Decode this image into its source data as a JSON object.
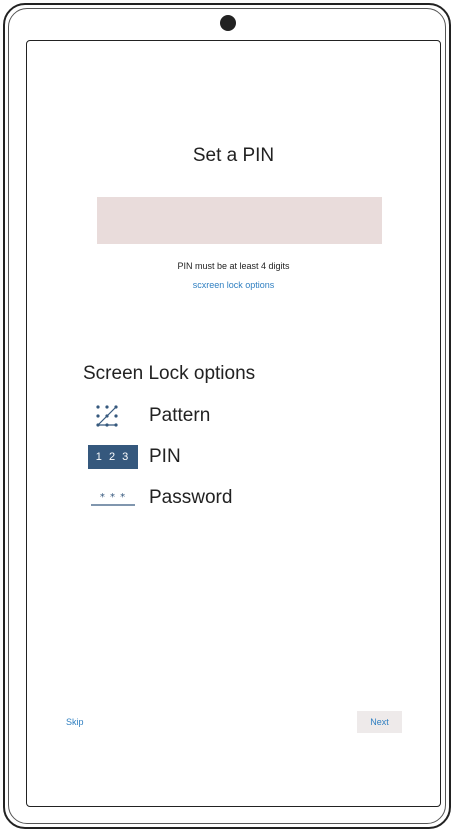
{
  "pin_setup": {
    "title": "Set a PIN",
    "input_value": "",
    "input_placeholder": "",
    "hint": "PIN must be at least 4 digits",
    "lock_options_link": "scxreen lock options"
  },
  "lock_options": {
    "title": "Screen Lock options",
    "items": [
      {
        "label": "Pattern",
        "icon": "pattern-icon"
      },
      {
        "label": "PIN",
        "icon": "pin-icon",
        "icon_text": "1 2 3"
      },
      {
        "label": "Password",
        "icon": "password-icon",
        "icon_text": "⁎⁎⁎"
      }
    ]
  },
  "footer": {
    "skip_label": "Skip",
    "next_label": "Next"
  },
  "colors": {
    "input_bg": "#e9dcdb",
    "link": "#2f7fc1",
    "pin_icon_bg": "#35587d",
    "next_bg": "#eeeaea"
  }
}
